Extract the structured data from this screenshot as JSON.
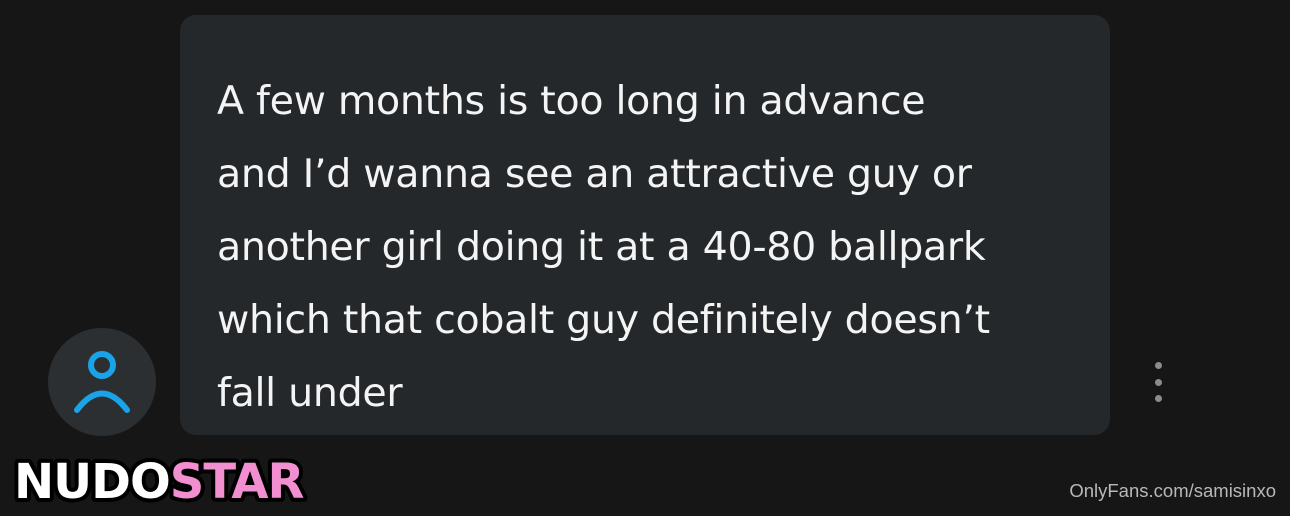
{
  "message": {
    "text": "A few months is too long in advance\nand I’d wanna see an attractive guy or\nanother girl doing it at a 40-80 ballpark\nwhich that cobalt guy definitely doesn’t\nfall under"
  },
  "avatar": {
    "icon": "person-outline-icon",
    "icon_color": "#1aa3e8"
  },
  "menu": {
    "icon": "vertical-ellipsis-icon"
  },
  "logo": {
    "part1": "NUDO",
    "part2": "STAR",
    "part1_color": "#ffffff",
    "part2_color": "#f28fd0"
  },
  "watermark": {
    "text": "OnlyFans.com/samisinxo"
  },
  "colors": {
    "background": "#161616",
    "bubble": "#24282a",
    "text": "#f4f4f4"
  }
}
